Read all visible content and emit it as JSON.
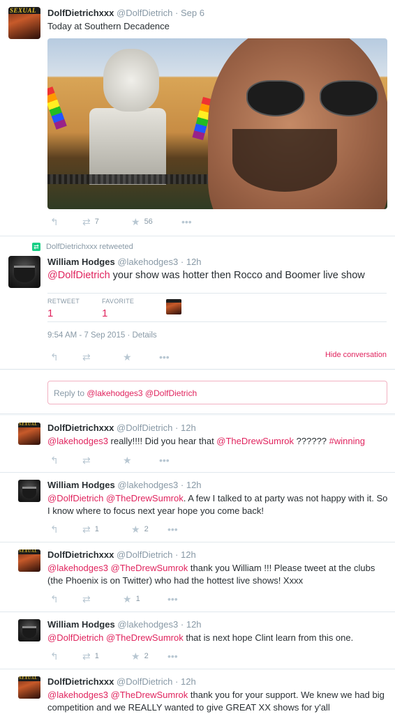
{
  "tweets": [
    {
      "name": "DolfDietrichxxx",
      "handle": "@DolfDietrich",
      "time": "Sep 6",
      "text": "Today at Southern Decadence",
      "retweets": "7",
      "favorites": "56"
    }
  ],
  "retweet_banner": "DolfDietrichxxx retweeted",
  "focus": {
    "name": "William Hodges",
    "handle": "@lakehodges3",
    "time": "12h",
    "mention": "@DolfDietrich",
    "text": " your show was hotter then Rocco and Boomer live show",
    "retweet_label": "RETWEET",
    "favorite_label": "FAVORITE",
    "retweet_count": "1",
    "favorite_count": "1",
    "timestamp": "9:54 AM - 7 Sep 2015",
    "details": "Details",
    "hide_conversation": "Hide conversation"
  },
  "reply_box": {
    "prefix": "Reply to ",
    "mentions": "@lakehodges3 @DolfDietrich"
  },
  "replies": [
    {
      "name": "DolfDietrichxxx",
      "handle": "@DolfDietrich",
      "time": "12h",
      "m1": "@lakehodges3",
      "t1": " really!!!! Did you hear that ",
      "m2": "@TheDrewSumrok",
      "t2": " ?????? ",
      "m3": "#winning",
      "retweets": "",
      "favorites": ""
    },
    {
      "name": "William Hodges",
      "handle": "@lakehodges3",
      "time": "12h",
      "m1": "@DolfDietrich @TheDrewSumrok",
      "t1": ".  A few I talked to at party was not happy with it.  So I know where to focus next year hope you come back!",
      "retweets": "1",
      "favorites": "2"
    },
    {
      "name": "DolfDietrichxxx",
      "handle": "@DolfDietrich",
      "time": "12h",
      "m1": "@lakehodges3 @TheDrewSumrok",
      "t1": " thank you William !!! Please tweet at the clubs (the Phoenix is on Twitter) who had the hottest live shows! Xxxx",
      "retweets": "",
      "favorites": "1"
    },
    {
      "name": "William Hodges",
      "handle": "@lakehodges3",
      "time": "12h",
      "m1": "@DolfDietrich @TheDrewSumrok",
      "t1": " that is next hope Clint learn from this one.",
      "retweets": "1",
      "favorites": "2"
    },
    {
      "name": "DolfDietrichxxx",
      "handle": "@DolfDietrich",
      "time": "12h",
      "m1": "@lakehodges3 @TheDrewSumrok",
      "t1": " thank you for your support. We knew we had big competition and we REALLY wanted to give GREAT XX shows for y'all"
    }
  ],
  "dot": "·",
  "avatar_logo": "SEXUAL",
  "icons": {
    "reply": "reply-icon",
    "retweet": "retweet-icon",
    "favorite": "star-icon",
    "more": "more-icon"
  },
  "colors": {
    "accent": "#e0245e",
    "retweet_green": "#19cf86",
    "muted": "#8899a6"
  }
}
